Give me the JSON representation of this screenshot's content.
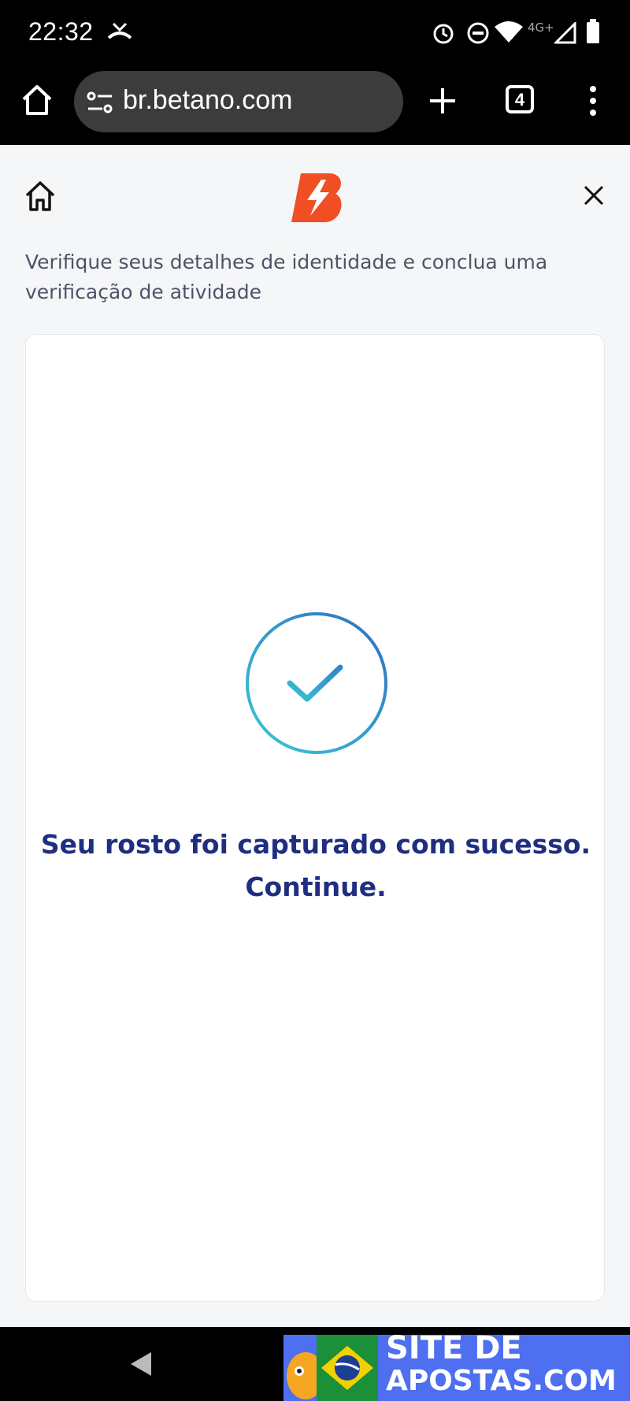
{
  "status_bar": {
    "time": "22:32",
    "network": "4G+"
  },
  "browser": {
    "url": "br.betano.com",
    "tab_count": "4"
  },
  "page": {
    "description": "Verifique seus detalhes de identidade e conclua uma verificação de atividade",
    "success_message": "Seu rosto foi capturado com sucesso. Continue."
  },
  "watermark": {
    "line1": "SITE DE",
    "line2": "APOSTAS.COM"
  },
  "colors": {
    "brand_orange": "#f04e23",
    "title_navy": "#1f2e80",
    "check_teal": "#33bcd3",
    "check_blue": "#2d7bc4"
  }
}
